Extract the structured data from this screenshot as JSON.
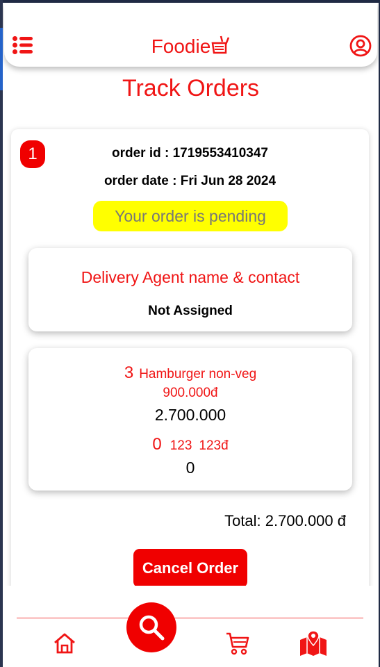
{
  "header": {
    "brand": "Foodie",
    "menu_icon": "list-icon",
    "brand_icon": "food-cart-icon",
    "profile_icon": "user-circle-icon"
  },
  "page": {
    "title": "Track Orders"
  },
  "order": {
    "index": "1",
    "id_text": "order id : 1719553410347",
    "date_text": "order date : Fri Jun 28 2024",
    "status": "Your order is pending",
    "agent_title": "Delivery Agent name & contact",
    "agent_value": "Not Assigned",
    "items": [
      {
        "qty": "3",
        "name": "Hamburger non-veg",
        "price": "900.000đ",
        "subtotal": "2.700.000"
      },
      {
        "qty": "0",
        "name": "123",
        "price": "123đ",
        "subtotal": "0"
      }
    ],
    "total": "Total: 2.700.000 đ",
    "cancel_label": "Cancel Order"
  },
  "bottom_nav": {
    "items": [
      "home-icon",
      "search-icon",
      "cart-icon",
      "map-icon"
    ]
  },
  "colors": {
    "accent": "#f01515",
    "status_bg": "#ffff00",
    "button": "#f00000"
  }
}
